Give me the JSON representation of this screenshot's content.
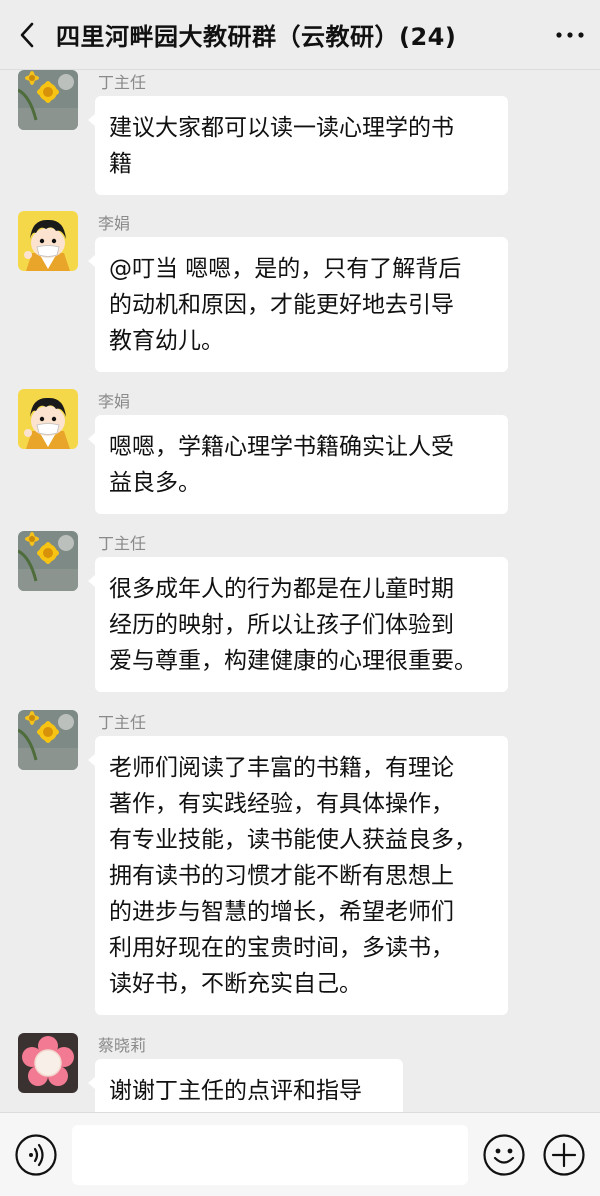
{
  "header": {
    "title": "四里河畔园大教研群（云教研）(24)",
    "back_icon": "chevron-left-icon",
    "more_icon": "more-dots-icon"
  },
  "messages": [
    {
      "sender": "丁主任",
      "avatar": "flower-photo-avatar",
      "lines": [
        "建议大家都可以读一读心理学的书",
        "籍"
      ]
    },
    {
      "sender": "李娟",
      "avatar": "cartoon-boy-avatar",
      "lines": [
        "@叮当  嗯嗯，是的，只有了解背后",
        "的动机和原因，才能更好地去引导",
        "教育幼儿。"
      ]
    },
    {
      "sender": "李娟",
      "avatar": "cartoon-boy-avatar",
      "lines": [
        "嗯嗯，学籍心理学书籍确实让人受",
        "益良多。"
      ]
    },
    {
      "sender": "丁主任",
      "avatar": "flower-photo-avatar",
      "lines": [
        "很多成年人的行为都是在儿童时期",
        "经历的映射，所以让孩子们体验到",
        "爱与尊重，构建健康的心理很重要。"
      ]
    },
    {
      "sender": "丁主任",
      "avatar": "flower-photo-avatar",
      "lines": [
        "老师们阅读了丰富的书籍，有理论",
        "著作，有实践经验，有具体操作，",
        "有专业技能，读书能使人获益良多，",
        "拥有读书的习惯才能不断有思想上",
        "的进步与智慧的增长，希望老师们",
        "利用好现在的宝贵时间，多读书，",
        "读好书，不断充实自己。"
      ]
    },
    {
      "sender": "蔡晓莉",
      "avatar": "pink-flower-avatar",
      "lines": [
        "谢谢丁主任的点评和指导"
      ]
    }
  ],
  "input_bar": {
    "voice_icon": "voice-icon",
    "input_value": "",
    "emoji_icon": "emoji-icon",
    "plus_icon": "plus-icon"
  },
  "colors": {
    "background": "#ededed",
    "bubble": "#ffffff",
    "sender_text": "#8a8a8a"
  }
}
